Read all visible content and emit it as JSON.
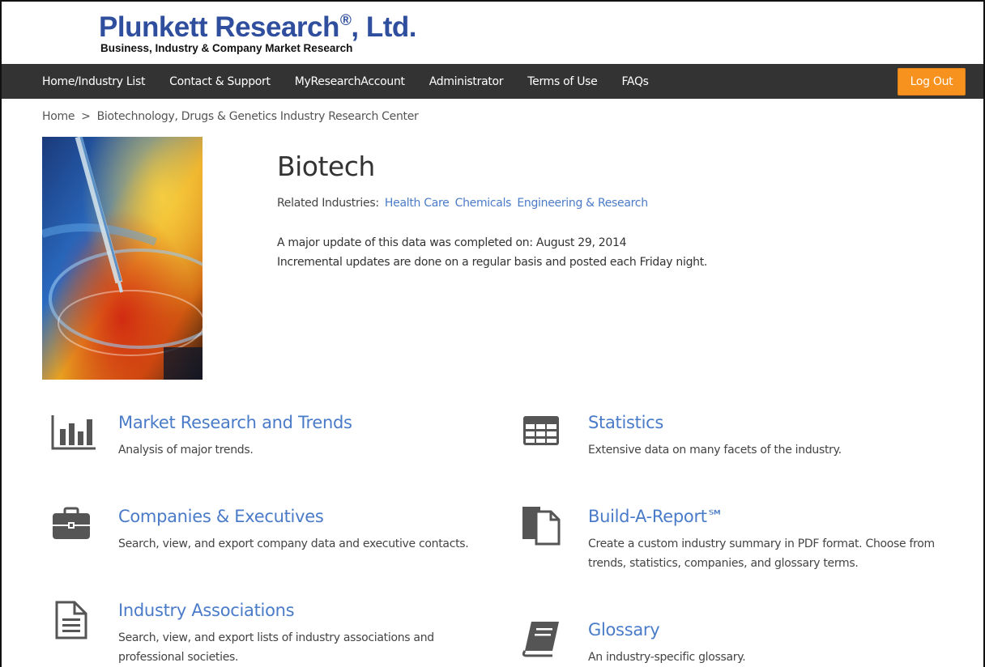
{
  "logo": {
    "title": "Plunkett Research",
    "registered": "®",
    "suffix": ", Ltd.",
    "subtitle": "Business, Industry & Company Market Research"
  },
  "nav": {
    "items": [
      "Home/Industry List",
      "Contact & Support",
      "MyResearchAccount",
      "Administrator",
      "Terms of Use",
      "FAQs"
    ],
    "logout": "Log Out"
  },
  "breadcrumb": {
    "home": "Home",
    "separator": ">",
    "current": "Biotechnology, Drugs & Genetics Industry Research Center"
  },
  "page": {
    "title": "Biotech",
    "related_label": "Related Industries:",
    "related": [
      "Health Care",
      "Chemicals",
      "Engineering & Research"
    ],
    "update_line1": "A major update of this data was completed on: August 29, 2014",
    "update_line2": "Incremental updates are done on a regular basis and posted each Friday night."
  },
  "features": [
    {
      "icon": "bar-chart-icon",
      "title": "Market Research and Trends",
      "desc": "Analysis of major trends."
    },
    {
      "icon": "table-grid-icon",
      "title": "Statistics",
      "desc": "Extensive data on many facets of the industry."
    },
    {
      "icon": "briefcase-icon",
      "title": "Companies & Executives",
      "desc": "Search, view, and export company data and executive contacts."
    },
    {
      "icon": "report-pages-icon",
      "title": "Build-A-Report℠",
      "desc": "Create a custom industry summary in PDF format. Choose from trends, statistics, companies, and glossary terms."
    },
    {
      "icon": "document-icon",
      "title": "Industry Associations",
      "desc": "Search, view, and export lists of industry associations and professional societies."
    },
    {
      "icon": "book-icon",
      "title": "Glossary",
      "desc": "An industry-specific glossary."
    }
  ],
  "colors": {
    "nav_bg": "#333333",
    "logout_bg": "#f7921e",
    "link": "#4a7bc8",
    "logo": "#2f4f9e"
  }
}
